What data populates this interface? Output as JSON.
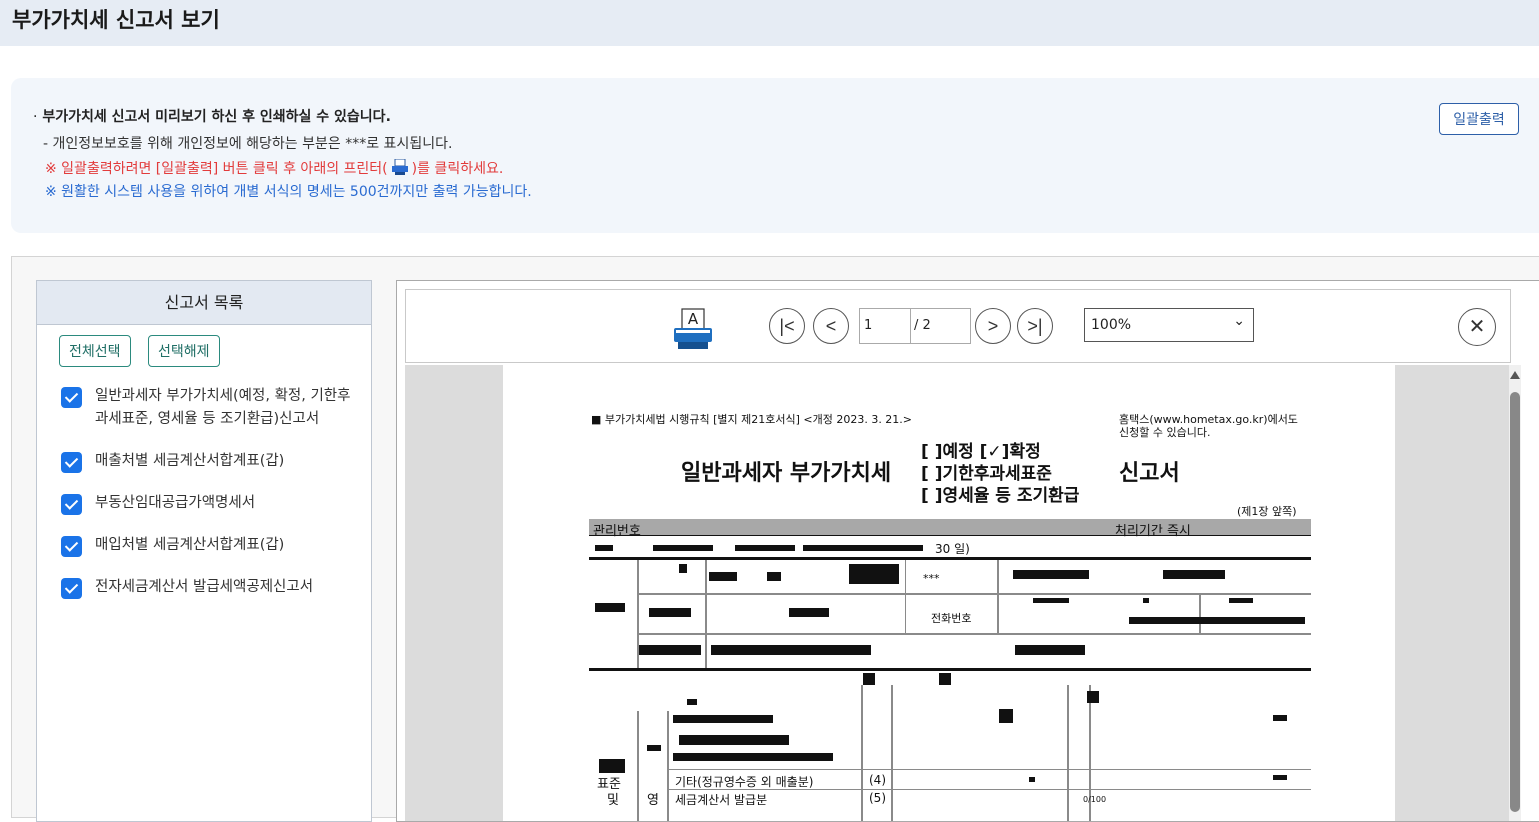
{
  "page_title": "부가가치세 신고서 보기",
  "notice": {
    "line1": "부가가치세 신고서 미리보기 하신 후 인쇄하실 수 있습니다.",
    "line2": "- 개인정보보호를 위해 개인정보에 해당하는 부분은 ***로 표시됩니다.",
    "line3_a": "※ 일괄출력하려면 [일괄출력] 버튼 클릭 후 아래의 프린터(",
    "line3_b": ")를 클릭하세요.",
    "line4": "※ 원활한 시스템 사용을 위하여 개별 서식의 명세는 500건까지만 출력 가능합니다.",
    "print_all_label": "일괄출력"
  },
  "sidebar": {
    "title": "신고서 목록",
    "select_all_label": "전체선택",
    "deselect_label": "선택해제",
    "items": [
      {
        "label": "일반과세자 부가가치세(예정, 확정, 기한후과세표준, 영세율 등 조기환급)신고서",
        "checked": true
      },
      {
        "label": "매출처별 세금계산서합계표(갑)",
        "checked": true
      },
      {
        "label": "부동산임대공급가액명세서",
        "checked": true
      },
      {
        "label": "매입처별 세금계산서합계표(갑)",
        "checked": true
      },
      {
        "label": "전자세금계산서 발급세액공제신고서",
        "checked": true
      }
    ]
  },
  "viewer": {
    "current_page": "1",
    "total_pages": "/ 2",
    "zoom": "100%",
    "zoom_options": [
      "100%"
    ],
    "icons": {
      "print": "printer-icon",
      "first": "first-page-icon",
      "prev": "prev-page-icon",
      "next": "next-page-icon",
      "last": "last-page-icon",
      "close": "close-icon"
    }
  },
  "document": {
    "regulation": "■ 부가가치세법 시행규칙 [별지 제21호서식] <개정 2023. 3. 21.>",
    "hometax_note_1": "홈택스(www.hometax.go.kr)에서도",
    "hometax_note_2": "신청할 수 있습니다.",
    "title_left": "일반과세자 부가가치세",
    "title_right": "신고서",
    "option_1": "[  ]예정  [✓]확정",
    "option_2": "[  ]기한후과세표준",
    "option_3": "[  ]영세율 등 조기환급",
    "page_side": "(제1장 앞쪽)",
    "mgmt_no": "관리번호",
    "processing": "처리기간  즉시",
    "period": "30 일)",
    "masked": "***",
    "phone": "전화번호",
    "row_label_1": "과세",
    "row_label_2": "표준",
    "row_label_3": "및",
    "sub_label": "영",
    "row4_text": "기타(정규영수증 외 매출분)",
    "row4_no": "(4)",
    "row5_text": "세금계산서 발급분",
    "row5_no": "(5)",
    "rate": "0/100"
  },
  "colors": {
    "title_bg": "#e6ecf4",
    "notice_bg": "#f2f6fb",
    "red": "#e23b3b",
    "blue": "#2a6bd1",
    "checkbox": "#1a73e8",
    "print_button": "#2d5fa8",
    "select_button": "#2b8a7e"
  }
}
